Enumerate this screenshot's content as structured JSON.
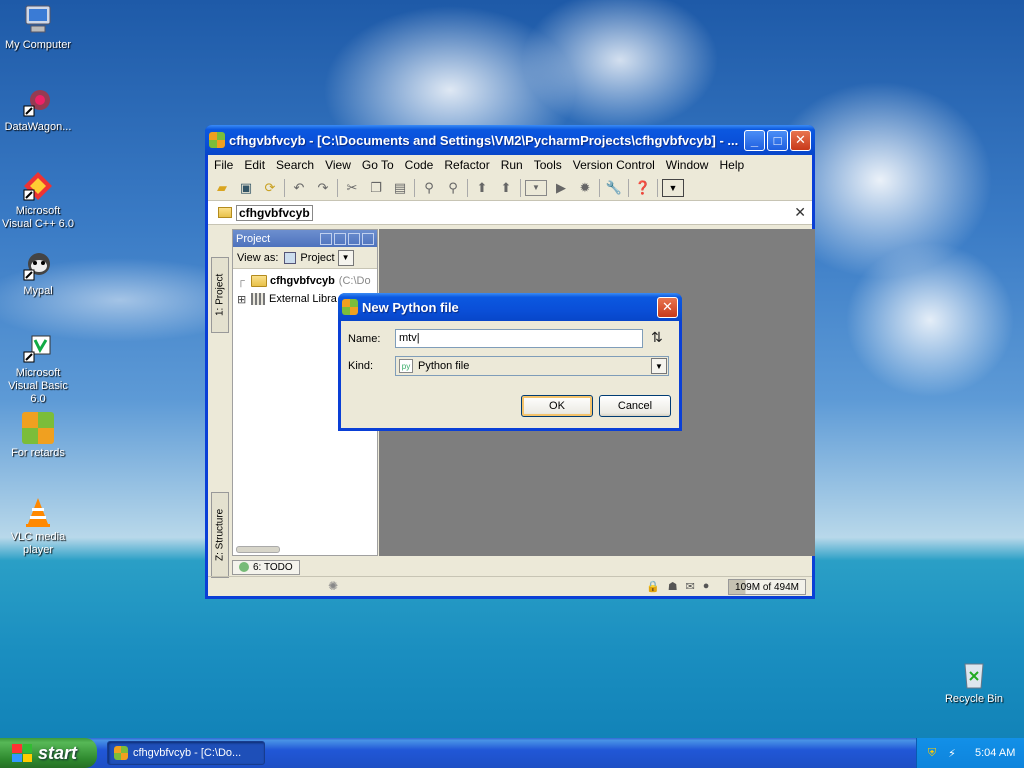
{
  "desktop": {
    "icons": [
      {
        "label": "My Computer"
      },
      {
        "label": "DataWagon..."
      },
      {
        "label": "Microsoft Visual C++ 6.0"
      },
      {
        "label": "Mypal"
      },
      {
        "label": "Microsoft Visual Basic 6.0"
      },
      {
        "label": "For retards"
      },
      {
        "label": "VLC media player"
      },
      {
        "label": "Recycle Bin"
      }
    ]
  },
  "window": {
    "title": "cfhgvbfvcyb - [C:\\Documents and Settings\\VM2\\PycharmProjects\\cfhgvbfvcyb] - ...",
    "menu": [
      "File",
      "Edit",
      "Search",
      "View",
      "Go To",
      "Code",
      "Refactor",
      "Run",
      "Tools",
      "Version Control",
      "Window",
      "Help"
    ],
    "breadcrumb": "cfhgvbfvcyb",
    "left_tabs": {
      "project": "1: Project",
      "structure": "Z: Structure"
    },
    "project_panel": {
      "header": "Project",
      "view_as_label": "View as:",
      "view_as_value": "Project",
      "tree": [
        {
          "label": "cfhgvbfvcyb",
          "path": "(C:\\Do"
        },
        {
          "label": "External Libra"
        }
      ]
    },
    "todo_button": "6: TODO",
    "memory": "109M of 494M",
    "memory_used_fraction": 0.22
  },
  "dialog": {
    "title": "New Python file",
    "name_label": "Name:",
    "name_value": "mtv",
    "kind_label": "Kind:",
    "kind_value": "Python file",
    "ok_label": "OK",
    "cancel_label": "Cancel"
  },
  "taskbar": {
    "start_label": "start",
    "task_item": "cfhgvbfvcyb - [C:\\Do...",
    "clock": "5:04 AM"
  }
}
